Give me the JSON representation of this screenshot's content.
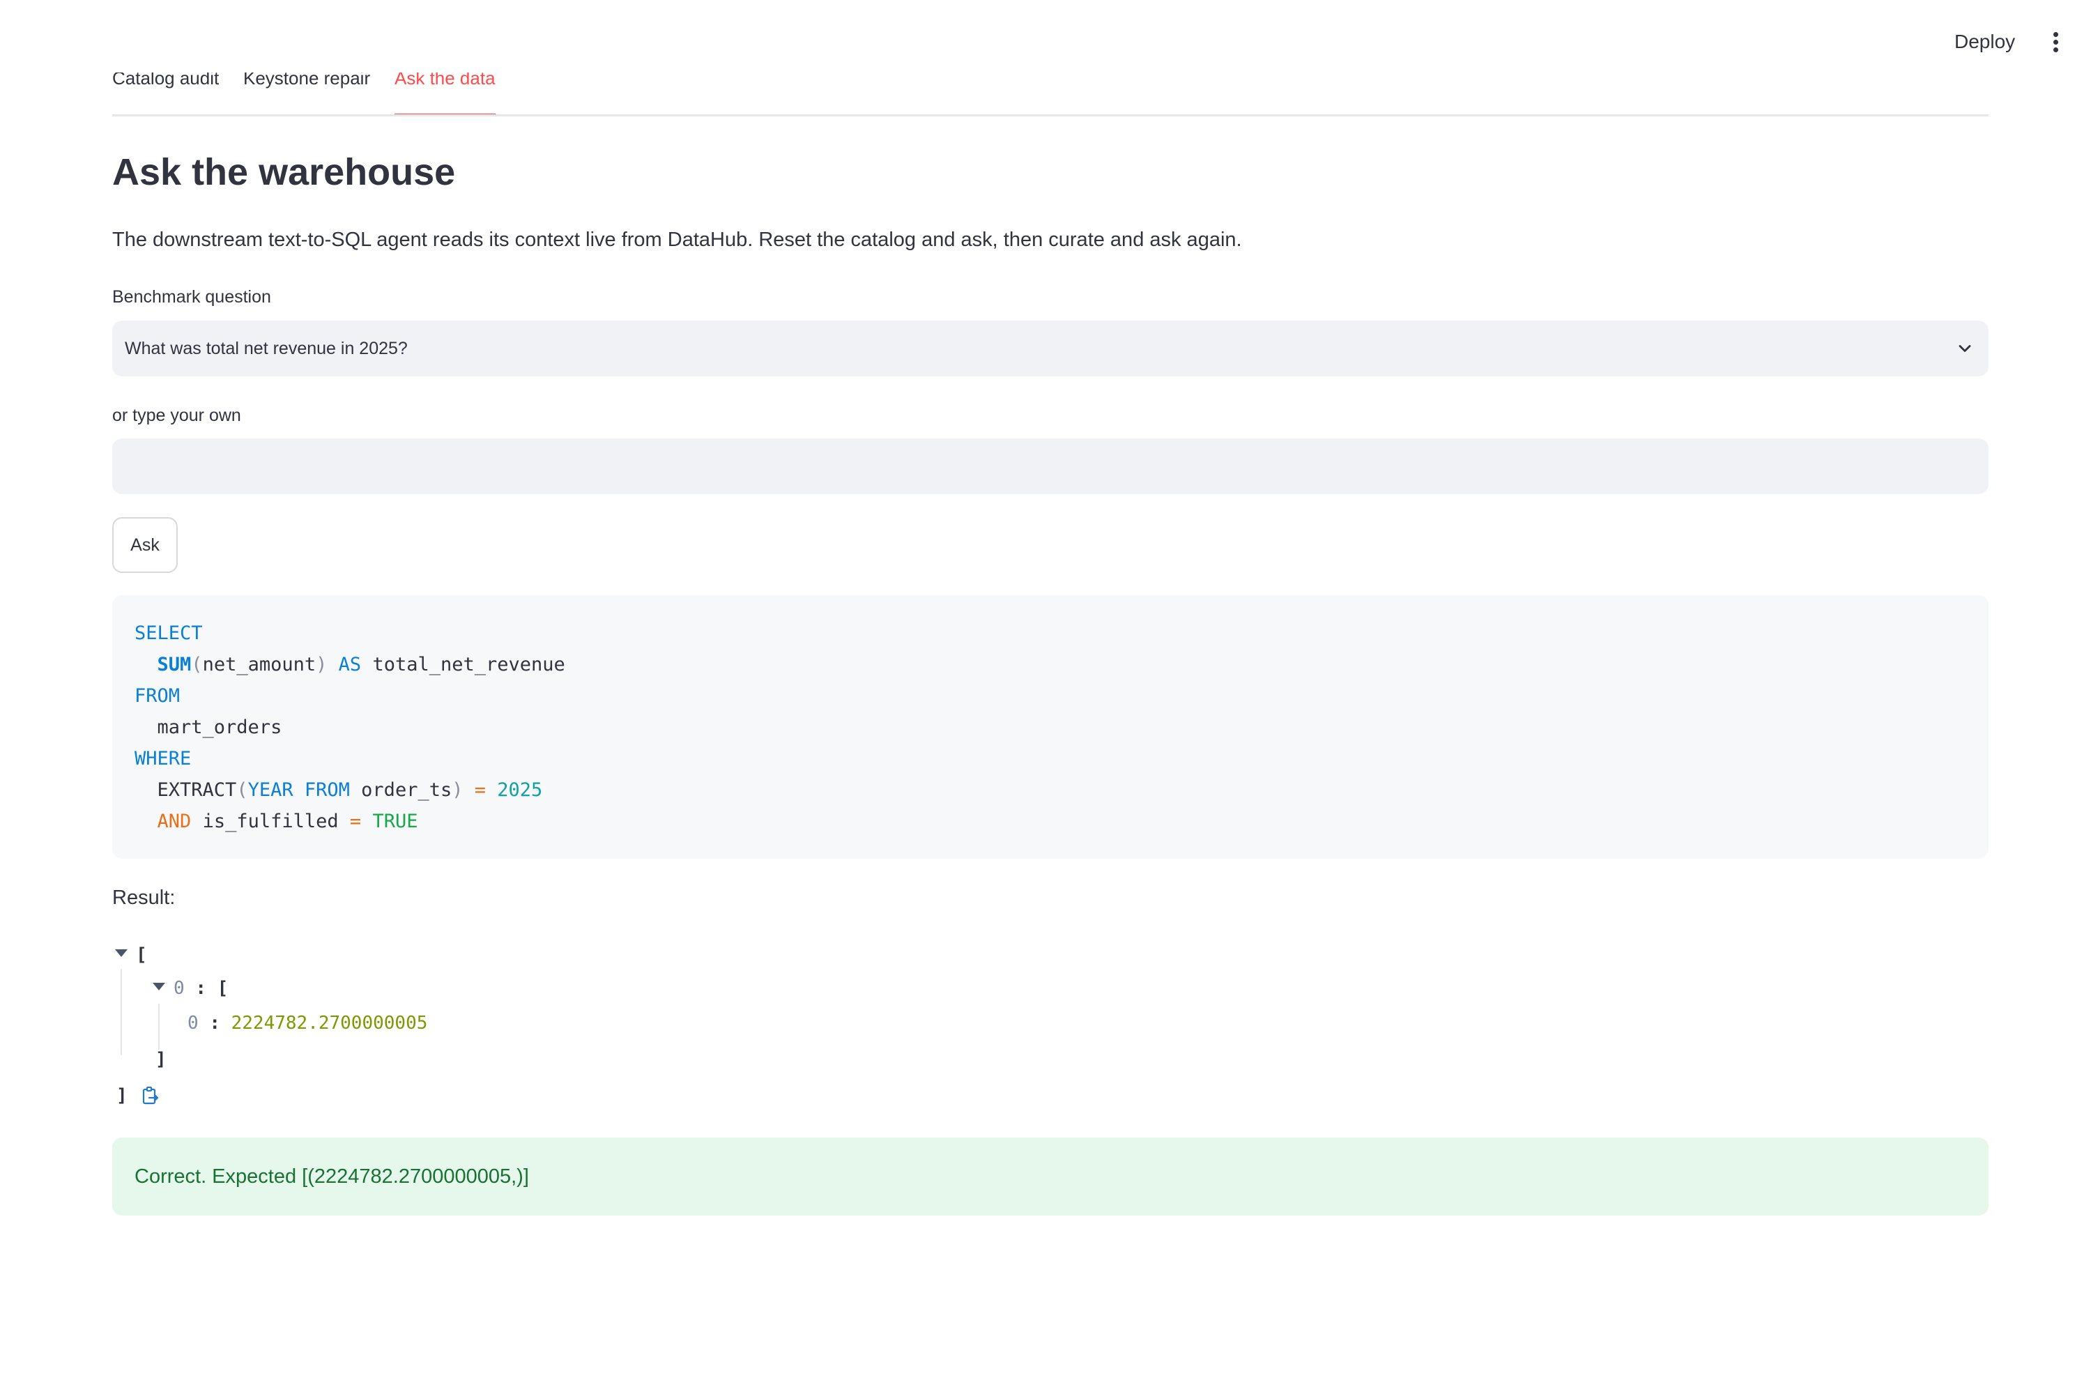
{
  "header": {
    "deploy_label": "Deploy",
    "menu_icon": "kebab-menu-icon"
  },
  "tabs": [
    {
      "label": "Catalog audit",
      "active": false
    },
    {
      "label": "Keystone repair",
      "active": false
    },
    {
      "label": "Ask the data",
      "active": true
    }
  ],
  "page": {
    "title": "Ask the warehouse",
    "description": "The downstream text-to-SQL agent reads its context live from DataHub. Reset the catalog and ask, then curate and ask again."
  },
  "benchmark": {
    "label": "Benchmark question",
    "selected": "What was total net revenue in 2025?",
    "icon": "chevron-down-icon"
  },
  "custom_question": {
    "label": "or type your own",
    "value": "",
    "placeholder": ""
  },
  "ask_button": {
    "label": "Ask"
  },
  "sql": {
    "select_kw": "SELECT",
    "sum_fn": "SUM",
    "open_paren": "(",
    "sum_arg": "net_amount",
    "close_paren": ")",
    "as_kw": "AS",
    "alias": "total_net_revenue",
    "from_kw": "FROM",
    "table": "mart_orders",
    "where_kw": "WHERE",
    "extract_fn": "EXTRACT",
    "year_kw": "YEAR",
    "from_kw2": "FROM",
    "extract_arg": "order_ts",
    "eq1": "=",
    "year_val": "2025",
    "and_kw": "AND",
    "bool_col": "is_fulfilled",
    "eq2": "=",
    "bool_val": "TRUE"
  },
  "result": {
    "label": "Result:",
    "open_bracket": "[",
    "close_bracket": "]",
    "outer_index": "0",
    "inner_index": "0",
    "colon": ":",
    "value": "2224782.2700000005",
    "copy_icon": "copy-to-clipboard-icon"
  },
  "status": {
    "message": "Correct. Expected [(2224782.2700000005,)]",
    "color": "#177233",
    "background": "#e6f8ec"
  },
  "colors": {
    "accent": "#ff4b4b",
    "sql_keyword": "#0a7fd6",
    "sql_operator": "#e8701a",
    "sql_number": "#0fa3a3",
    "sql_boolean": "#17a84a",
    "json_value": "#7a9a01"
  }
}
